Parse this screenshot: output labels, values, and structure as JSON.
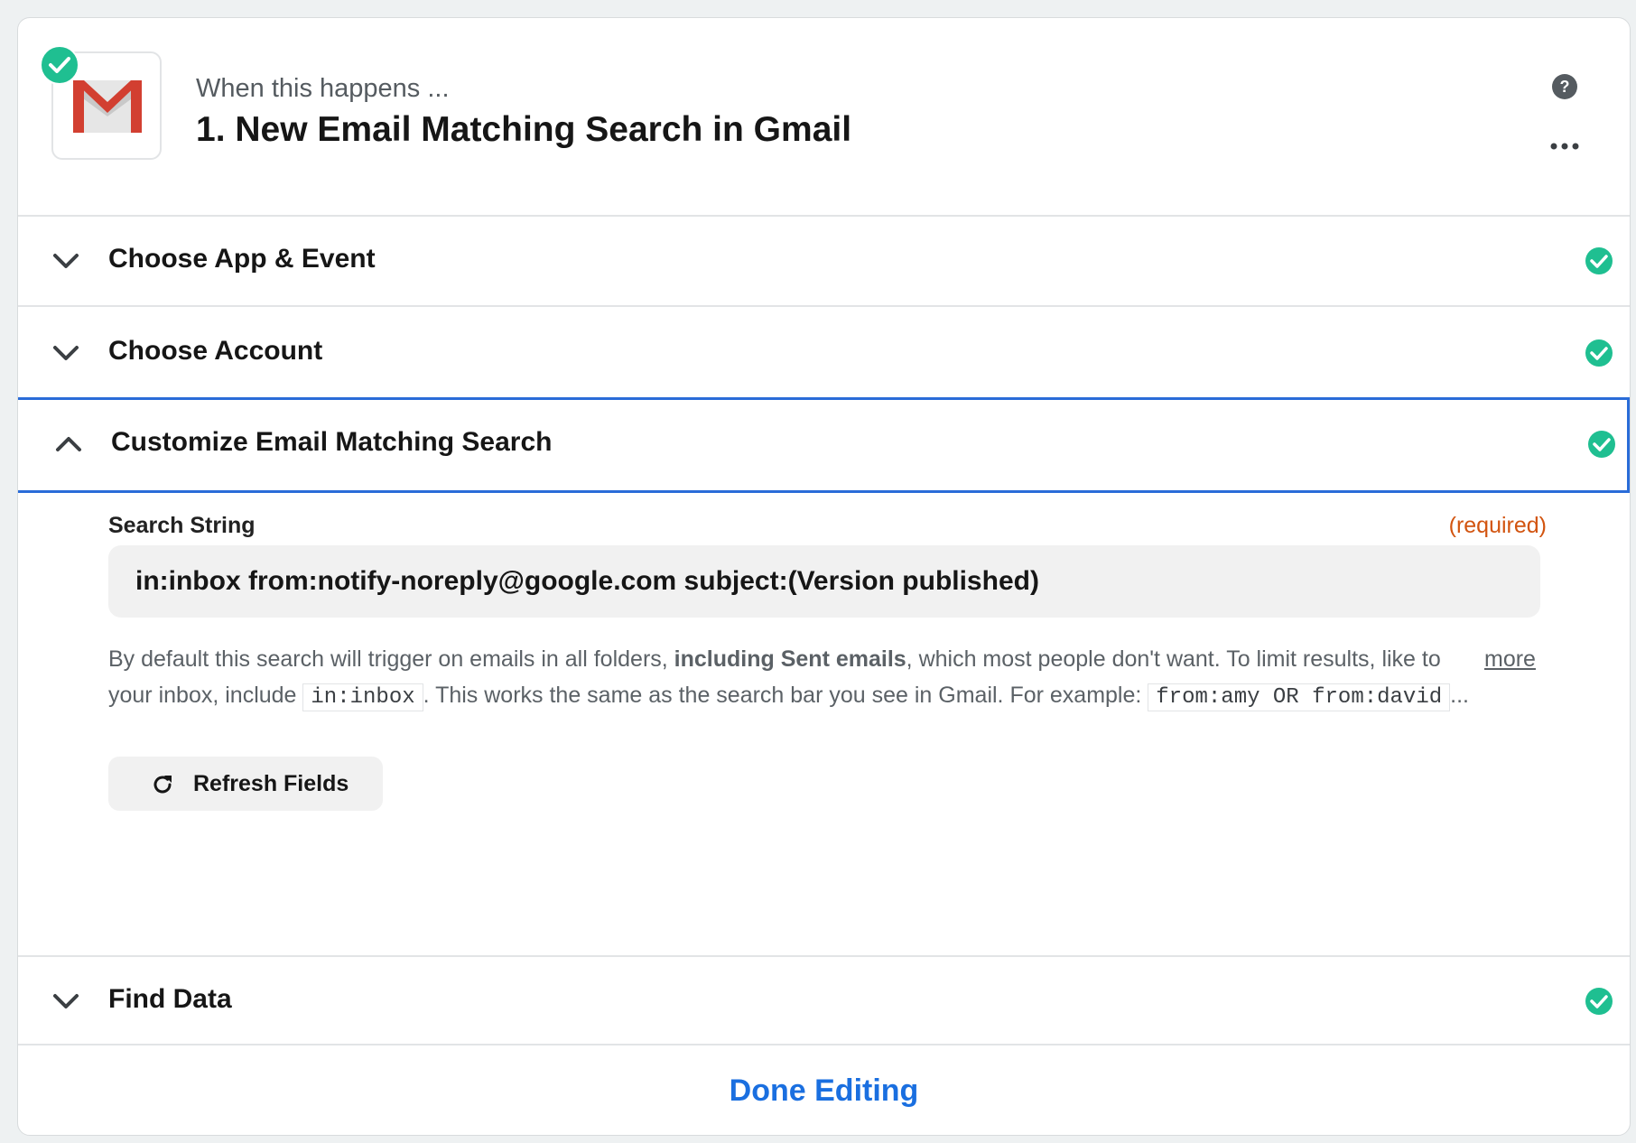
{
  "header": {
    "subtitle": "When this happens ...",
    "title": "1. New Email Matching Search in Gmail"
  },
  "sections": [
    {
      "label": "Choose App & Event",
      "state": "collapsed",
      "status": "complete"
    },
    {
      "label": "Choose Account",
      "state": "collapsed",
      "status": "complete"
    },
    {
      "label": "Customize Email Matching Search",
      "state": "expanded",
      "status": "complete"
    },
    {
      "label": "Find Data",
      "state": "collapsed",
      "status": "complete"
    }
  ],
  "field": {
    "label": "Search String",
    "required_text": "(required)",
    "value": "in:inbox from:notify-noreply@google.com subject:(Version published)"
  },
  "help": {
    "part1": "By default this search will trigger on emails in all folders, ",
    "bold": "including Sent emails",
    "part2": ", which most people don't want. To limit results, like to your inbox, include ",
    "code1": "in:inbox",
    "part3": ". This works the same as the search bar you see in Gmail. For example: ",
    "code2": "from:amy OR from:david",
    "ellipsis": "...",
    "more": "more"
  },
  "refresh_button": {
    "label": "Refresh Fields"
  },
  "done_button": {
    "label": "Done Editing"
  },
  "colors": {
    "accent": "#2a6cd8",
    "success": "#1fbf91",
    "required": "#d2540f",
    "link": "#1a6fe0"
  },
  "icons": {
    "app": "gmail-logo",
    "status": "check-circle-icon",
    "help": "question-circle-icon",
    "menu": "more-horizontal-icon",
    "refresh": "refresh-icon"
  }
}
